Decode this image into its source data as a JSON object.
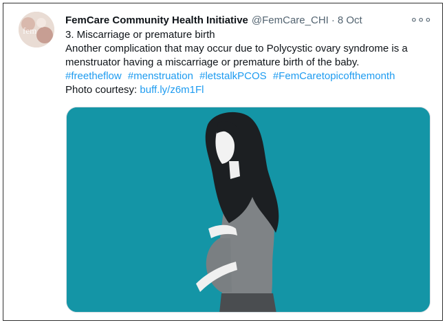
{
  "tweet": {
    "author_name": "FemCare Community Health Initiative",
    "handle": "@FemCare_CHI",
    "separator": "·",
    "date": "8 Oct",
    "more_icon": "more-options-icon",
    "line1": "3. Miscarriage or premature birth",
    "line2": "Another complication that may occur due to Polycystic ovary syndrome is a menstruator having a miscarriage or premature birth of the baby.",
    "hashtags": [
      "#freetheflow",
      "#menstruation",
      "#letstalkPCOS",
      "#FemCaretopicofthemonth"
    ],
    "photo_label": "Photo courtesy:",
    "photo_link": "buff.ly/z6m1Fl"
  },
  "avatar": {
    "text": "fem"
  },
  "media": {
    "background_color": "#1495a6",
    "subject": "illustration of a pregnant woman with long dark hair holding her belly"
  }
}
